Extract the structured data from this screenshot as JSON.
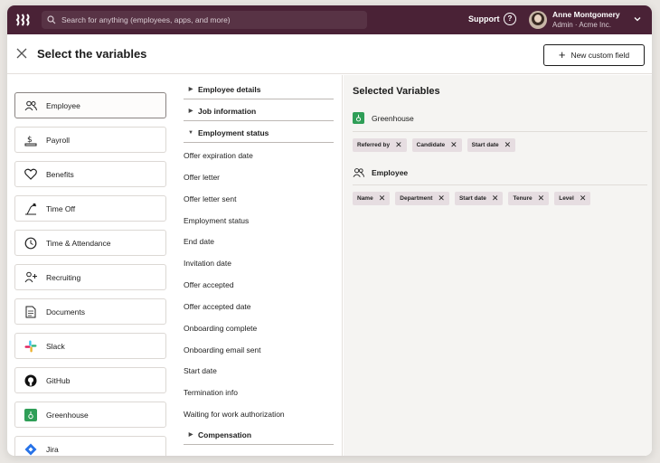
{
  "topbar": {
    "search_placeholder": "Search for anything (employees, apps, and more)",
    "support_label": "Support",
    "user_name": "Anne Montgomery",
    "user_company": "Admin · Acme Inc."
  },
  "header": {
    "title": "Select the variables",
    "new_button_label": "New custom field"
  },
  "categories": [
    {
      "label": "Employee",
      "icon": "people-icon",
      "selected": true
    },
    {
      "label": "Payroll",
      "icon": "payroll-icon"
    },
    {
      "label": "Benefits",
      "icon": "heart-icon"
    },
    {
      "label": "Time Off",
      "icon": "time-off-icon"
    },
    {
      "label": "Time & Attendance",
      "icon": "clock-icon"
    },
    {
      "label": "Recruiting",
      "icon": "recruiting-icon"
    },
    {
      "label": "Documents",
      "icon": "document-icon"
    },
    {
      "label": "Slack",
      "icon": "slack-icon"
    },
    {
      "label": "GitHub",
      "icon": "github-icon"
    },
    {
      "label": "Greenhouse",
      "icon": "greenhouse-icon"
    },
    {
      "label": "Jira",
      "icon": "jira-icon"
    }
  ],
  "groups": {
    "employee_details": "Employee details",
    "job_information": "Job information",
    "employment_status": "Employment status",
    "compensation": "Compensation"
  },
  "fields": [
    "Offer expiration date",
    "Offer letter",
    "Offer letter sent",
    "Employment status",
    "End date",
    "Invitation date",
    "Offer accepted",
    "Offer accepted date",
    "Onboarding complete",
    "Onboarding email sent",
    "Start date",
    "Termination info",
    "Waiting for work authorization"
  ],
  "selected": {
    "title": "Selected Variables",
    "greenhouse_label": "Greenhouse",
    "greenhouse_chips": [
      "Referred by",
      "Candidate",
      "Start date"
    ],
    "employee_label": "Employee",
    "employee_chips": [
      "Name",
      "Department",
      "Start date",
      "Tenure",
      "Level"
    ]
  },
  "colors": {
    "topbar": "#4a2236",
    "chip": "#e6dde1",
    "greenhouse": "#2f9e57",
    "jira": "#2672e8"
  }
}
